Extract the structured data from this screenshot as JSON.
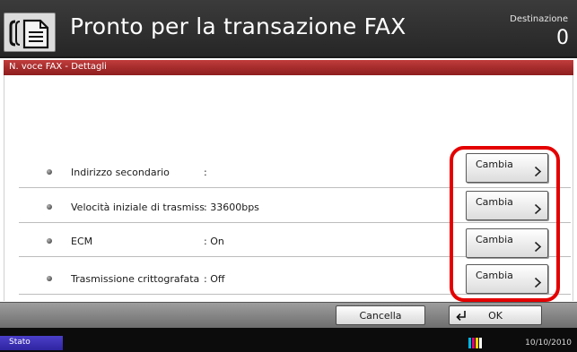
{
  "header": {
    "title": "Pronto per la transazione FAX",
    "destination_label": "Destinazione",
    "destination_count": "0",
    "mode_icon": "fax-document-icon"
  },
  "title_bar": {
    "text": "N. voce FAX - Dettagli",
    "color": "#b22a2a"
  },
  "settings": [
    {
      "label": "Indirizzo secondario",
      "separator": ":",
      "value": "",
      "button": "Cambia"
    },
    {
      "label": "Velocità iniziale di trasmiss",
      "separator": ":",
      "value": "33600bps",
      "button": "Cambia"
    },
    {
      "label": "ECM",
      "separator": ":",
      "value": "On",
      "button": "Cambia"
    },
    {
      "label": "Trasmissione crittografata",
      "separator": ":",
      "value": "Off",
      "button": "Cambia"
    }
  ],
  "footer": {
    "cancel_label": "Cancella",
    "ok_label": "OK"
  },
  "status_bar": {
    "status_label": "Stato",
    "date": "10/10/2010",
    "toner_icon": "toner-level-icon"
  },
  "colors": {
    "highlight": "#e40000",
    "status_button": "#3a2fb8"
  }
}
